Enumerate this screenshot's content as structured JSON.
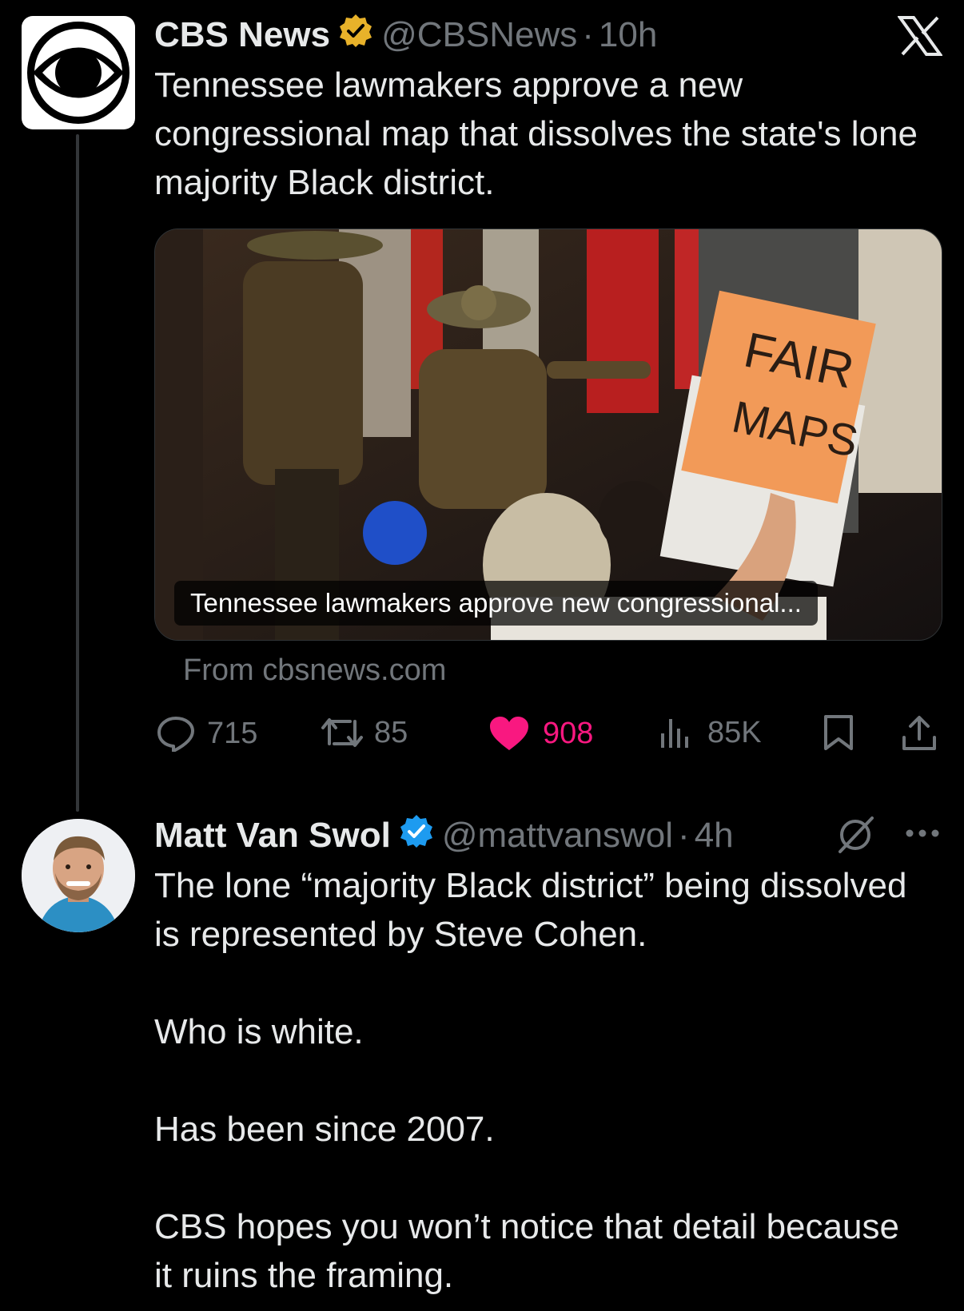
{
  "top_right": {
    "x_logo_icon": "x-logo-icon"
  },
  "tweet": {
    "author_name": "CBS News",
    "handle": "@CBSNews",
    "dot": "·",
    "time": "10h",
    "text": "Tennessee lawmakers approve a new congressional map that dissolves the state's lone majority Black district.",
    "card": {
      "caption": "Tennessee lawmakers approve new congressional...",
      "sign_text_line1": "FAIR",
      "sign_text_line2": "MAPS",
      "source": "From cbsnews.com"
    },
    "actions": {
      "replies": "715",
      "retweets": "85",
      "likes": "908",
      "views": "85K"
    },
    "colors": {
      "like": "#f91880",
      "verified_gold": "#e8b22a"
    }
  },
  "reply": {
    "author_name": "Matt Van Swol",
    "handle": "@mattvanswol",
    "dot": "·",
    "time": "4h",
    "text": "The lone “majority Black district” being dissolved is represented by Steve Cohen.\n\nWho is white.\n\nHas been since 2007.\n\nCBS hopes you won’t notice that detail because it ruins the framing.",
    "colors": {
      "verified_blue": "#1d9bf0"
    }
  }
}
